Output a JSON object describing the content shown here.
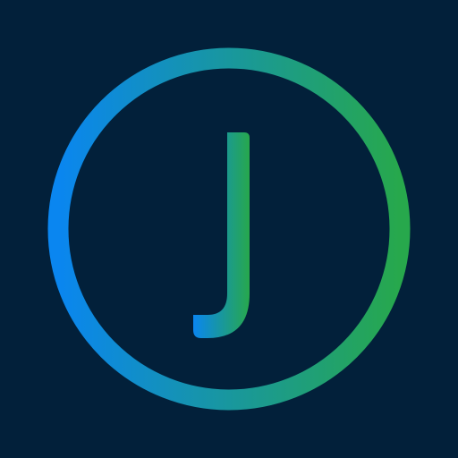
{
  "logo": {
    "letter": "J",
    "icon": "circle-letter-j-logo-icon",
    "colors": {
      "background": "#02203a",
      "gradient_start": "#0a86f0",
      "gradient_end": "#27a84c"
    }
  }
}
